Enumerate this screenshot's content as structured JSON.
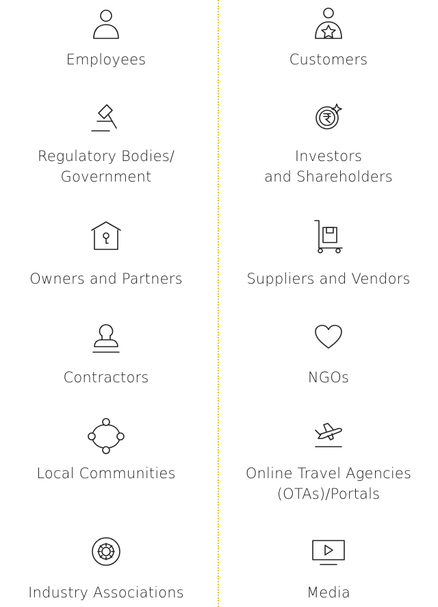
{
  "stakeholders": {
    "left": [
      {
        "label": "Employees",
        "icon": "person-icon"
      },
      {
        "label": "Regulatory Bodies/\nGovernment",
        "icon": "gavel-icon"
      },
      {
        "label": "Owners and Partners",
        "icon": "house-key-icon"
      },
      {
        "label": "Contractors",
        "icon": "stamp-icon"
      },
      {
        "label": "Local Communities",
        "icon": "community-network-icon"
      },
      {
        "label": "Industry Associations",
        "icon": "gear-network-icon"
      }
    ],
    "right": [
      {
        "label": "Customers",
        "icon": "customer-star-icon"
      },
      {
        "label": "Investors\nand Shareholders",
        "icon": "rupee-investment-icon"
      },
      {
        "label": "Suppliers and Vendors",
        "icon": "trolley-box-icon"
      },
      {
        "label": "NGOs",
        "icon": "heart-icon"
      },
      {
        "label": "Online Travel Agencies\n(OTAs)/Portals",
        "icon": "airplane-icon"
      },
      {
        "label": "Media",
        "icon": "video-play-icon"
      }
    ]
  },
  "colors": {
    "divider": "#f2c200",
    "text": "#222222"
  }
}
